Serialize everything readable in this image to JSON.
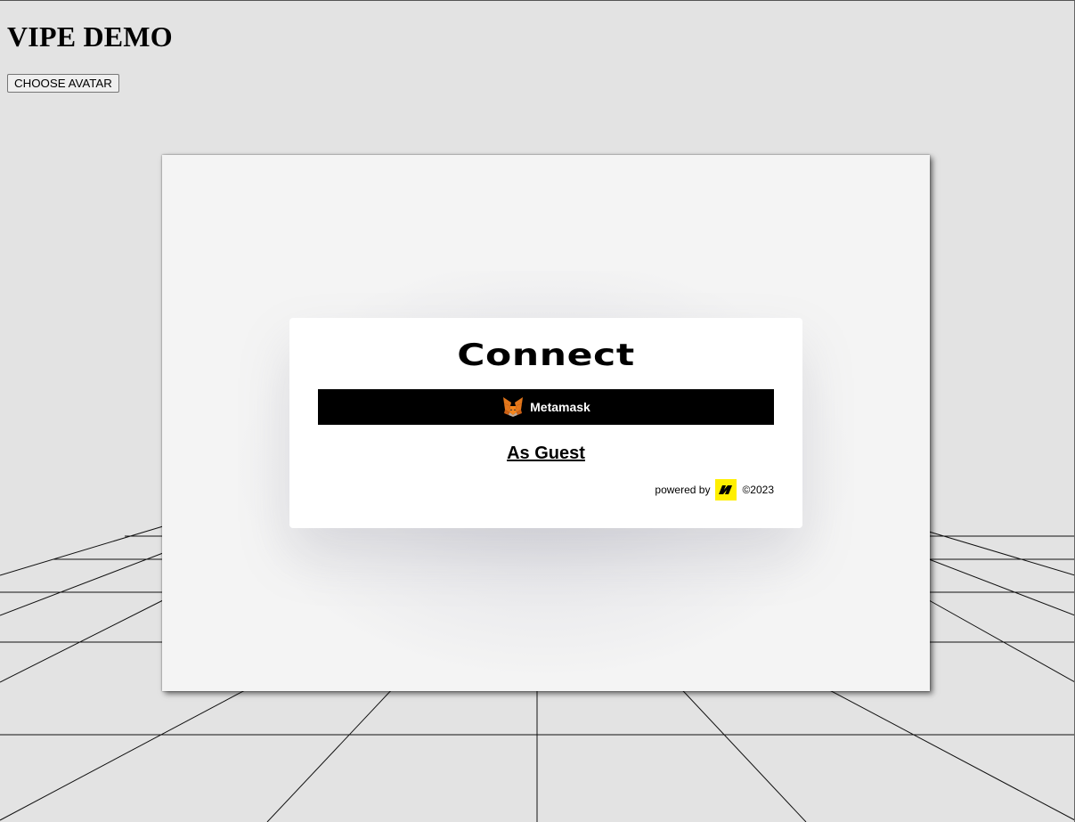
{
  "page": {
    "title": "VIPE DEMO"
  },
  "toolbar": {
    "choose_avatar_label": "CHOOSE AVATAR"
  },
  "connect": {
    "title": "Connect",
    "metamask_label": "Metamask",
    "guest_label": "As Guest",
    "powered_by": "powered by",
    "copyright": "©2023"
  },
  "colors": {
    "background": "#e3e3e3",
    "viewport": "#f4f4f4",
    "button_black": "#000000",
    "logo_yellow": "#ffef00",
    "fox_orange": "#e2761b"
  },
  "icons": {
    "metamask": "fox-icon",
    "brand_logo": "brand-logo-icon"
  }
}
